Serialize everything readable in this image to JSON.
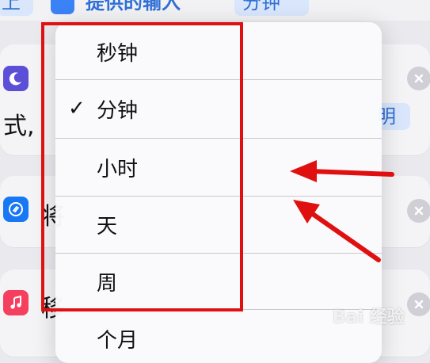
{
  "top_bar": {
    "chip_left": "上",
    "chip_middle": "提供的输入",
    "chip_right": "分钟"
  },
  "background_rows": {
    "text_1": "式,",
    "text_2": "将",
    "text_3": "移",
    "chip_partial": "明"
  },
  "menu": {
    "selected_index": 1,
    "items": [
      {
        "label": "秒钟",
        "selected": false
      },
      {
        "label": "分钟",
        "selected": true
      },
      {
        "label": "小时",
        "selected": false
      },
      {
        "label": "天",
        "selected": false
      },
      {
        "label": "周",
        "selected": false
      },
      {
        "label": "个月",
        "selected": false
      }
    ],
    "check_glyph": "✓"
  },
  "watermark": "Bai 经验",
  "colors": {
    "highlight": "#e01010",
    "arrow": "#e01010",
    "accent": "#2f6fd6"
  },
  "icons": {
    "moon": "moon-icon",
    "shazam": "shazam-icon",
    "music": "music-icon",
    "close": "close-icon"
  }
}
